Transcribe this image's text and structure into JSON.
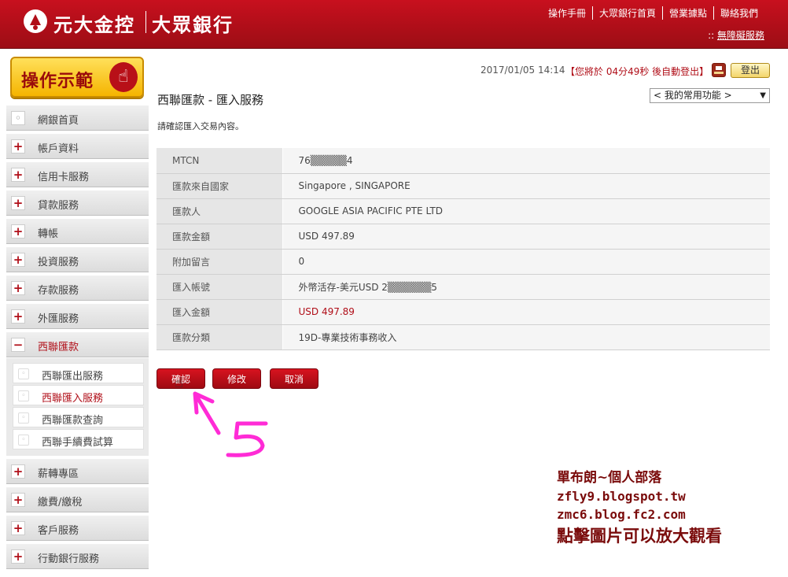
{
  "header": {
    "brand": "元大金控",
    "bank": "大眾銀行",
    "links": [
      "操作手冊",
      "大眾銀行首頁",
      "營業據點",
      "聯絡我們"
    ],
    "accessible_prefix": "::",
    "accessible_label": "無障礙服務"
  },
  "sidebar": {
    "demo_label": "操作示範",
    "items": [
      {
        "label": "網銀首頁",
        "bullet": "◦"
      },
      {
        "label": "帳戶資料",
        "bullet": "+"
      },
      {
        "label": "信用卡服務",
        "bullet": "+"
      },
      {
        "label": "貸款服務",
        "bullet": "+"
      },
      {
        "label": "轉帳",
        "bullet": "+"
      },
      {
        "label": "投資服務",
        "bullet": "+"
      },
      {
        "label": "存款服務",
        "bullet": "+"
      },
      {
        "label": "外匯服務",
        "bullet": "+"
      },
      {
        "label": "西聯匯款",
        "bullet": "−"
      }
    ],
    "sub_items": [
      {
        "label": "西聯匯出服務"
      },
      {
        "label": "西聯匯入服務"
      },
      {
        "label": "西聯匯款查詢"
      },
      {
        "label": "西聯手續費試算"
      }
    ],
    "items_after": [
      {
        "label": "薪轉專區",
        "bullet": "+"
      },
      {
        "label": "繳費/繳稅",
        "bullet": "+"
      },
      {
        "label": "客戶服務",
        "bullet": "+"
      },
      {
        "label": "行動銀行服務",
        "bullet": "+"
      }
    ]
  },
  "main": {
    "datetime": "2017/01/05 14:14",
    "autologout": "【您將於 04分49秒 後自動登出】",
    "logout_label": "登出",
    "page_title": "西聯匯款 - 匯入服務",
    "favorites": "< 我的常用功能 >",
    "confirm_msg": "請確認匯入交易內容。",
    "rows": [
      {
        "k": "MTCN",
        "v": "76▒▒▒▒▒4"
      },
      {
        "k": "匯款來自國家",
        "v": "Singapore , SINGAPORE"
      },
      {
        "k": "匯款人",
        "v": "GOOGLE ASIA PACIFIC PTE LTD"
      },
      {
        "k": "匯款金額",
        "v": "USD 497.89"
      },
      {
        "k": "附加留言",
        "v": "0"
      },
      {
        "k": "匯入帳號",
        "v": "外幣活存-美元USD 2▒▒▒▒▒▒5"
      },
      {
        "k": "匯入金額",
        "v": "USD 497.89"
      },
      {
        "k": "匯款分類",
        "v": "19D-專業技術事務收入"
      }
    ],
    "buttons": {
      "confirm": "確認",
      "edit": "修改",
      "cancel": "取消"
    }
  },
  "annotation": {
    "number": "5",
    "color": "#ff2bd6"
  },
  "blog": {
    "line1": "單布朗~個人部落",
    "line2": "zfly9.blogspot.tw",
    "line3": "zmc6.blog.fc2.com",
    "line4": "點擊圖片可以放大觀看"
  }
}
